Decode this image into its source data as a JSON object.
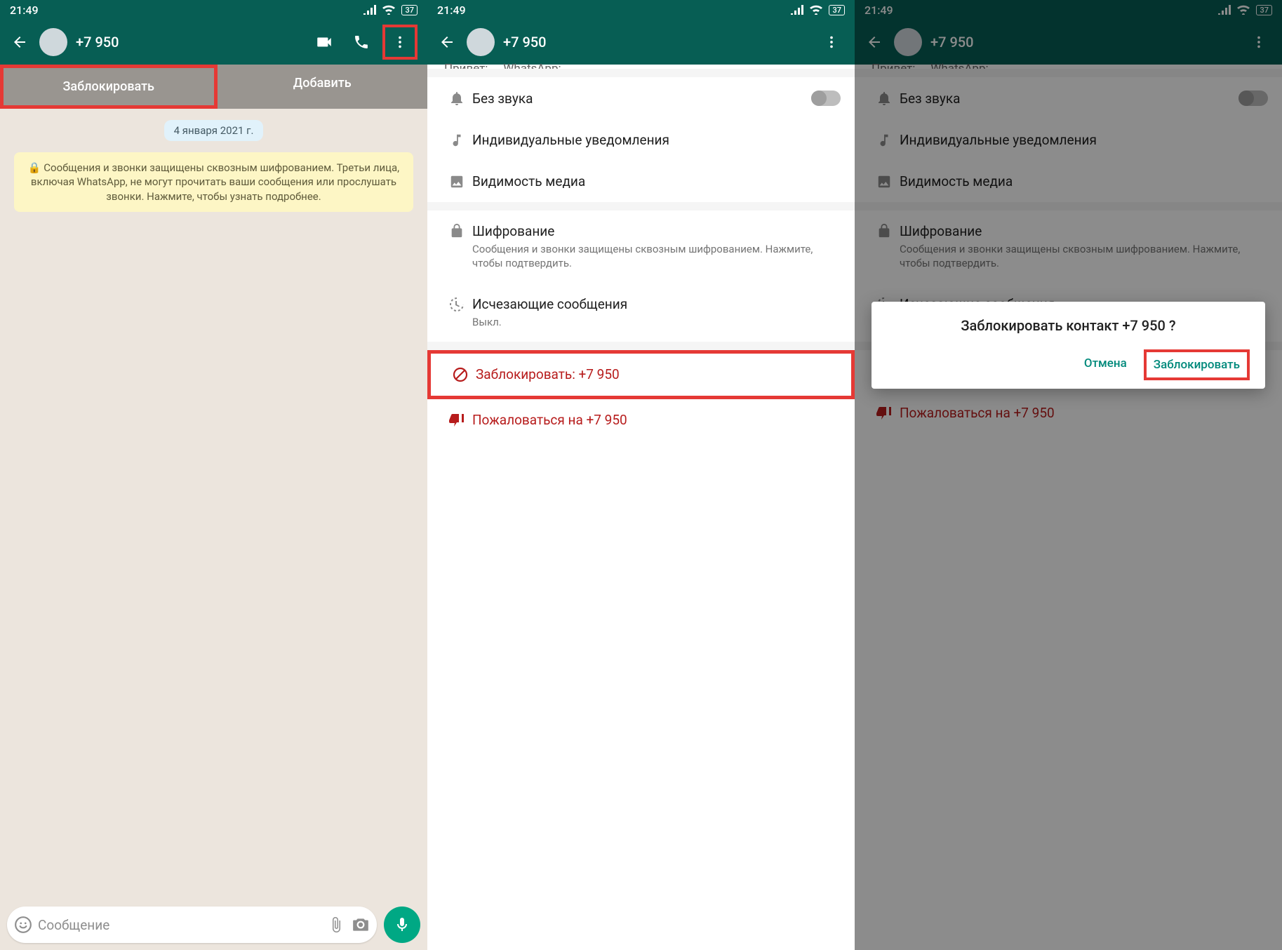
{
  "status_time": "21:49",
  "battery": "37",
  "contact": "+7 950",
  "screen1": {
    "block_label": "Заблокировать",
    "add_label": "Добавить",
    "date": "4 января 2021 г.",
    "encryption_info": "🔒 Сообщения и звонки защищены сквозным шифрованием. Третьи лица, включая WhatsApp, не могут прочитать ваши сообщения или прослушать звонки. Нажмите, чтобы узнать подробнее.",
    "compose_placeholder": "Сообщение"
  },
  "settings": {
    "obscured_top": "Привет: ... WhatsApp:",
    "mute": "Без звука",
    "custom_notif": "Индивидуальные уведомления",
    "media_visibility": "Видимость медиа",
    "encryption": "Шифрование",
    "encryption_sub": "Сообщения и звонки защищены сквозным шифрованием. Нажмите, чтобы подтвердить.",
    "disappearing": "Исчезающие сообщения",
    "disappearing_sub": "Выкл.",
    "block": "Заблокировать: +7 950",
    "report": "Пожаловаться на +7 950"
  },
  "dialog": {
    "title": "Заблокировать контакт +7 950 ?",
    "cancel": "Отмена",
    "confirm": "Заблокировать"
  }
}
